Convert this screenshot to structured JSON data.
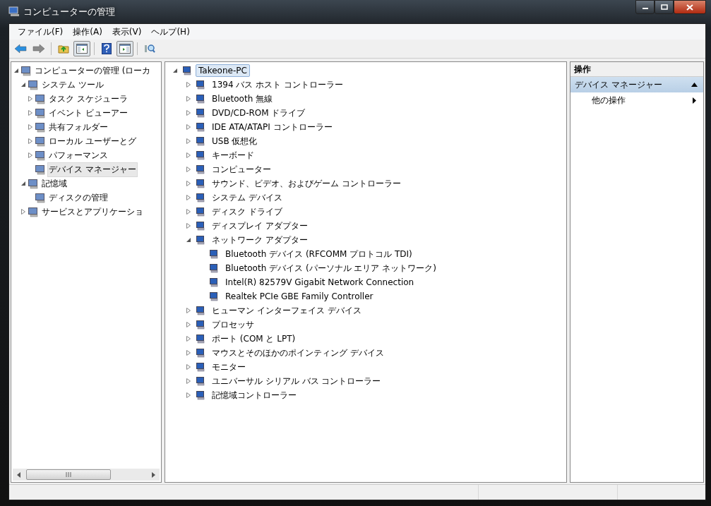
{
  "window": {
    "title": "コンピューターの管理"
  },
  "menu": [
    "ファイル(F)",
    "操作(A)",
    "表示(V)",
    "ヘルプ(H)"
  ],
  "toolbar": [
    {
      "kind": "back",
      "disabled": false,
      "on": false
    },
    {
      "kind": "forward",
      "disabled": true,
      "on": false
    },
    {
      "kind": "up",
      "on": false
    },
    {
      "kind": "tree-pane",
      "on": true
    },
    {
      "kind": "help",
      "on": false
    },
    {
      "kind": "action-pane",
      "on": true
    },
    {
      "kind": "properties",
      "on": false
    }
  ],
  "left_tree": [
    {
      "label": "コンピューターの管理 (ローカ",
      "expanded": true,
      "selected": false,
      "children": [
        {
          "label": "システム ツール",
          "expanded": true,
          "selected": false,
          "children": [
            {
              "label": "タスク スケジューラ",
              "expanded": false,
              "selected": false
            },
            {
              "label": "イベント ビューアー",
              "expanded": false,
              "selected": false
            },
            {
              "label": "共有フォルダー",
              "expanded": false,
              "selected": false
            },
            {
              "label": "ローカル ユーザーとグ",
              "expanded": false,
              "selected": false
            },
            {
              "label": "パフォーマンス",
              "expanded": false,
              "selected": false
            },
            {
              "label": "デバイス マネージャー",
              "selected": true
            }
          ]
        },
        {
          "label": "記憶域",
          "expanded": true,
          "selected": false,
          "children": [
            {
              "label": "ディスクの管理",
              "selected": false
            }
          ]
        },
        {
          "label": "サービスとアプリケーショ",
          "expanded": false,
          "selected": false
        }
      ]
    }
  ],
  "device_tree": [
    {
      "label": "Takeone-PC",
      "expanded": true,
      "selected": true,
      "children": [
        {
          "label": "1394 バス ホスト コントローラー",
          "expanded": false,
          "selected": false
        },
        {
          "label": "Bluetooth 無線",
          "expanded": false,
          "selected": false
        },
        {
          "label": "DVD/CD-ROM ドライブ",
          "expanded": false,
          "selected": false
        },
        {
          "label": "IDE ATA/ATAPI コントローラー",
          "expanded": false,
          "selected": false
        },
        {
          "label": "USB 仮想化",
          "expanded": false,
          "selected": false
        },
        {
          "label": "キーボード",
          "expanded": false,
          "selected": false
        },
        {
          "label": "コンピューター",
          "expanded": false,
          "selected": false
        },
        {
          "label": "サウンド、ビデオ、およびゲーム コントローラー",
          "expanded": false,
          "selected": false
        },
        {
          "label": "システム デバイス",
          "expanded": false,
          "selected": false
        },
        {
          "label": "ディスク ドライブ",
          "expanded": false,
          "selected": false
        },
        {
          "label": "ディスプレイ アダプター",
          "expanded": false,
          "selected": false
        },
        {
          "label": "ネットワーク アダプター",
          "expanded": true,
          "selected": false,
          "children": [
            {
              "label": "Bluetooth デバイス (RFCOMM プロトコル TDI)",
              "selected": false
            },
            {
              "label": "Bluetooth デバイス (パーソナル エリア ネットワーク)",
              "selected": false
            },
            {
              "label": "Intel(R) 82579V Gigabit Network Connection",
              "selected": false
            },
            {
              "label": "Realtek PCIe GBE Family Controller",
              "selected": false
            }
          ]
        },
        {
          "label": "ヒューマン インターフェイス デバイス",
          "expanded": false,
          "selected": false
        },
        {
          "label": "プロセッサ",
          "expanded": false,
          "selected": false
        },
        {
          "label": "ポート (COM と LPT)",
          "expanded": false,
          "selected": false
        },
        {
          "label": "マウスとそのほかのポインティング デバイス",
          "expanded": false,
          "selected": false
        },
        {
          "label": "モニター",
          "expanded": false,
          "selected": false
        },
        {
          "label": "ユニバーサル シリアル バス コントローラー",
          "expanded": false,
          "selected": false
        },
        {
          "label": "記憶域コントローラー",
          "expanded": false,
          "selected": false
        }
      ]
    }
  ],
  "actions": {
    "header": "操作",
    "sections": [
      {
        "title": "デバイス マネージャー",
        "expanded": true,
        "items": [
          {
            "label": "他の操作",
            "submenu": true
          }
        ]
      }
    ]
  }
}
